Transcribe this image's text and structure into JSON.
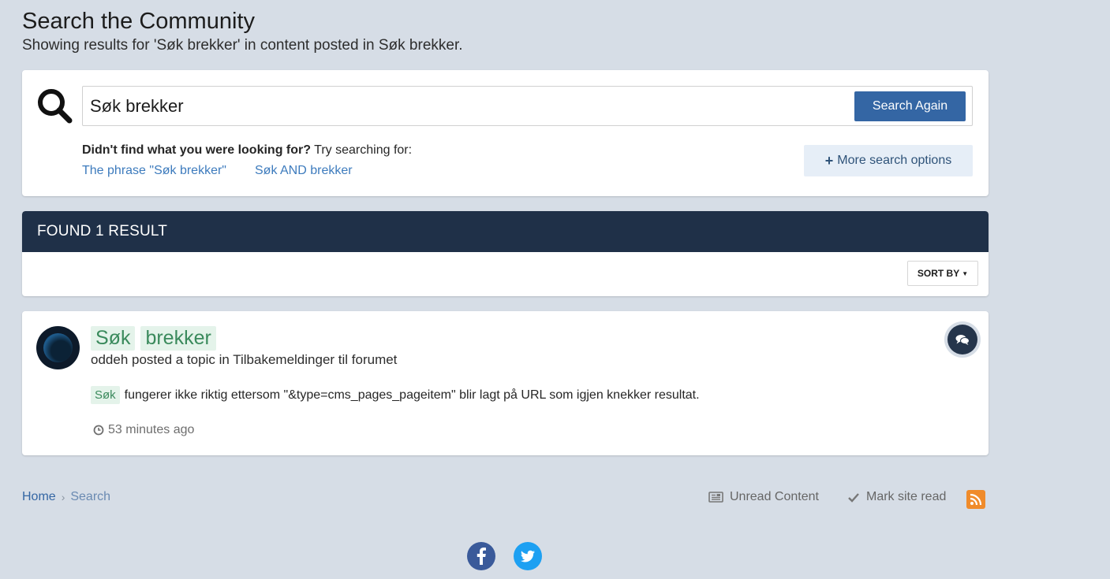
{
  "header": {
    "title": "Search the Community",
    "subtitle": "Showing results for 'Søk brekker' in content posted in Søk brekker."
  },
  "search": {
    "query": "Søk brekker",
    "button_label": "Search Again",
    "didnt_find_bold": "Didn't find what you were looking for?",
    "didnt_find_rest": " Try searching for:",
    "suggestions": [
      "The phrase \"Søk brekker\"",
      "Søk AND brekker"
    ],
    "more_options_label": "More search options"
  },
  "results": {
    "header": "FOUND 1 RESULT",
    "sort_label": "SORT BY"
  },
  "result": {
    "title_words": [
      "Søk",
      "brekker"
    ],
    "author": "oddeh",
    "meta_mid": " posted a topic in ",
    "forum": "Tilbakemeldinger til forumet",
    "snippet_highlight": "Søk",
    "snippet_text": "fungerer ikke riktig ettersom \"&type=cms_pages_pageitem\" blir lagt på URL som igjen knekker resultat.",
    "time": "53 minutes ago",
    "type_icon": "comments-icon"
  },
  "footer": {
    "breadcrumb": [
      "Home",
      "Search"
    ],
    "unread_label": "Unread Content",
    "mark_read_label": "Mark site read",
    "social": [
      "facebook-icon",
      "twitter-icon"
    ]
  },
  "colors": {
    "background": "#d6dde6",
    "primary_button": "#3466a4",
    "results_header": "#1f3048",
    "highlight_bg": "#e4f3ea",
    "highlight_text": "#3a8a5c",
    "rss": "#f08b2b",
    "facebook": "#3a5a9a",
    "twitter": "#1da0f2"
  }
}
